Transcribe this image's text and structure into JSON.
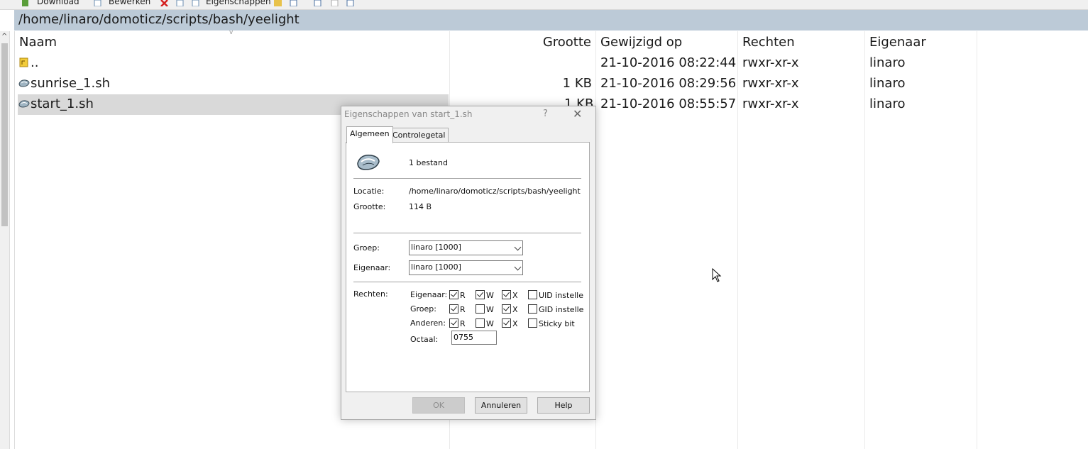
{
  "toolbar": {
    "download_label": "Download",
    "edit_label": "Bewerken",
    "properties_label": "Eigenschappen"
  },
  "path": "/home/linaro/domoticz/scripts/bash/yeelight",
  "columns": {
    "name": "Naam",
    "size": "Grootte",
    "modified": "Gewijzigd op",
    "rights": "Rechten",
    "owner": "Eigenaar"
  },
  "files": [
    {
      "name": "..",
      "size": "",
      "modified": "21-10-2016 08:22:44",
      "rights": "rwxr-xr-x",
      "owner": "linaro",
      "type": "parent"
    },
    {
      "name": "sunrise_1.sh",
      "size": "1 KB",
      "modified": "21-10-2016 08:29:56",
      "rights": "rwxr-xr-x",
      "owner": "linaro",
      "type": "script"
    },
    {
      "name": "start_1.sh",
      "size": "1 KB",
      "modified": "21-10-2016 08:55:57",
      "rights": "rwxr-xr-x",
      "owner": "linaro",
      "type": "script",
      "selected": true
    }
  ],
  "dialog": {
    "title": "Eigenschappen van start_1.sh",
    "help_glyph": "?",
    "close_glyph": "✕",
    "tabs": [
      "Algemeen",
      "Controlegetal"
    ],
    "summary": "1 bestand",
    "location_label": "Locatie:",
    "location_value": "/home/linaro/domoticz/scripts/bash/yeelight",
    "size_label": "Grootte:",
    "size_value": "114 B",
    "group_label": "Groep:",
    "group_value": "linaro [1000]",
    "owner_label": "Eigenaar:",
    "owner_value": "linaro [1000]",
    "rights_label": "Rechten:",
    "permissions": {
      "rows": [
        {
          "label": "Eigenaar:",
          "r": true,
          "w": true,
          "x": true,
          "extra_label": "UID instelle",
          "extra": false
        },
        {
          "label": "Groep:",
          "r": true,
          "w": false,
          "x": true,
          "extra_label": "GID instelle",
          "extra": false
        },
        {
          "label": "Anderen:",
          "r": true,
          "w": false,
          "x": true,
          "extra_label": "Sticky bit",
          "extra": false
        }
      ],
      "r_label": "R",
      "w_label": "W",
      "x_label": "X"
    },
    "octal_label": "Octaal:",
    "octal_value": "0755",
    "buttons": {
      "ok": "OK",
      "cancel": "Annuleren",
      "help": "Help"
    }
  }
}
